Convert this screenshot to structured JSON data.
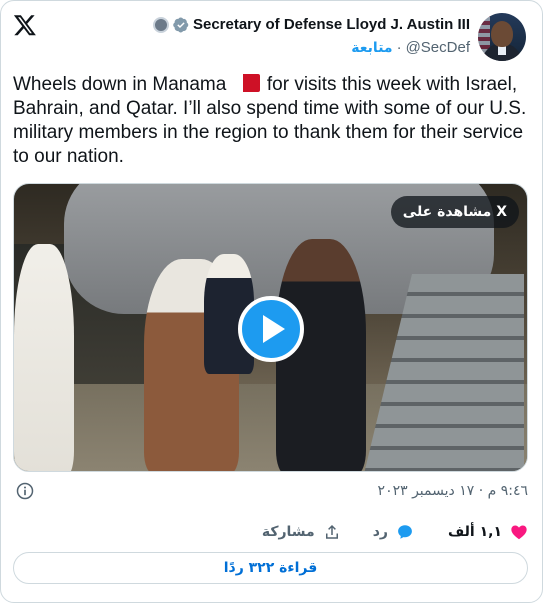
{
  "header": {
    "display_name": "Secretary of Defense Lloyd J. Austin III",
    "handle": "@SecDef",
    "separator": "·",
    "follow_label": "متابعة"
  },
  "tweet": {
    "text_before_flag": "Wheels down in Manama ",
    "flag_icon": "bahrain-flag-icon",
    "text_after_flag": " for visits this week with Israel, Bahrain, and Qatar. I’ll also spend time with some of our U.S. military members in the region to thank them for their service to our nation."
  },
  "media": {
    "watch_label": "مشاهدة على X"
  },
  "meta": {
    "timestamp": "٩:٤٦ م · ١٧ ديسمبر ٢٠٢٣"
  },
  "actions": {
    "like_count": "١,١ ألف",
    "reply_label": "رد",
    "share_label": "مشاركة"
  },
  "read_replies_label": "قراءة ٣٢٢ ردًا",
  "colors": {
    "accent": "#1d9bf0",
    "like": "#f91880",
    "text": "#0f1419",
    "secondary": "#536471",
    "link": "#006fd6"
  }
}
